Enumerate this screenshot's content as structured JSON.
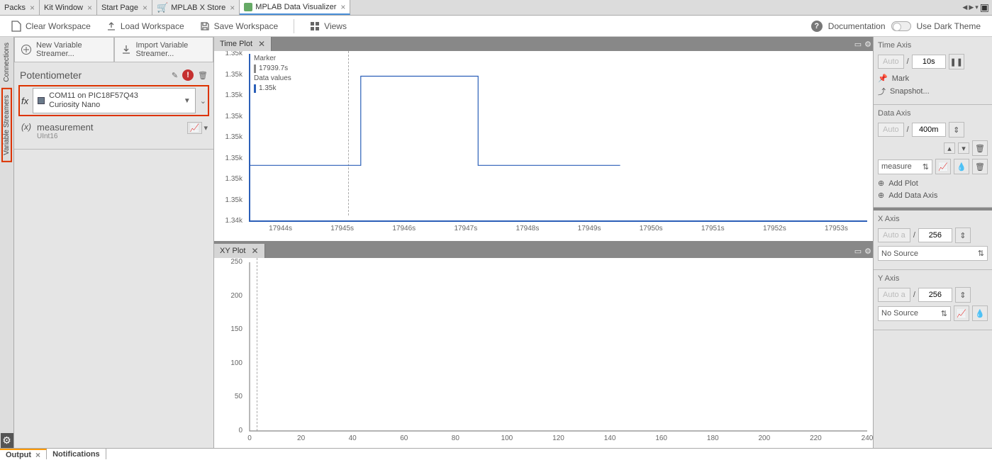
{
  "tabs": {
    "packs": "Packs",
    "kit": "Kit Window",
    "start": "Start Page",
    "store": "MPLAB X Store",
    "dv": "MPLAB Data Visualizer"
  },
  "toolbar": {
    "clear": "Clear Workspace",
    "load": "Load Workspace",
    "save": "Save Workspace",
    "views": "Views",
    "docs": "Documentation",
    "dark": "Use Dark Theme"
  },
  "leftRail": {
    "connections": "Connections",
    "streamers": "Variable Streamers"
  },
  "leftPanel": {
    "newBtn1": "New Variable",
    "newBtn2": "Streamer...",
    "importBtn1": "Import Variable",
    "importBtn2": "Streamer...",
    "streamerName": "Potentiometer",
    "sourceLine1": "COM11 on PIC18F57Q43",
    "sourceLine2": "Curiosity Nano",
    "varName": "measurement",
    "varType": "UInt16"
  },
  "timePlot": {
    "tab": "Time Plot",
    "legend": {
      "marker": "Marker",
      "markerTime": "17939.7s",
      "dataValues": "Data values",
      "value": "1.35k"
    },
    "yticks": [
      "1.35k",
      "1.35k",
      "1.35k",
      "1.35k",
      "1.35k",
      "1.35k",
      "1.35k",
      "1.35k",
      "1.34k"
    ],
    "xticks": [
      "17944s",
      "17945s",
      "17946s",
      "17947s",
      "17948s",
      "17949s",
      "17950s",
      "17951s",
      "17952s",
      "17953s"
    ]
  },
  "xyPlot": {
    "tab": "XY Plot",
    "yticks": [
      "250",
      "200",
      "150",
      "100",
      "50",
      "0"
    ],
    "xticks": [
      "0",
      "20",
      "40",
      "60",
      "80",
      "100",
      "120",
      "140",
      "160",
      "180",
      "200",
      "220",
      "240"
    ]
  },
  "rightPanel": {
    "timeAxis": "Time Axis",
    "dataAxis": "Data Axis",
    "xAxis": "X Axis",
    "yAxis": "Y Axis",
    "auto": "Auto",
    "autoA": "Auto a",
    "slash": "/",
    "timeRange": "10s",
    "dataRange": "400m",
    "xRange": "256",
    "yRange": "256",
    "mark": "Mark",
    "snapshot": "Snapshot...",
    "measure": "measure",
    "addPlot": "Add Plot",
    "addDataAxis": "Add Data Axis",
    "noSource": "No Source"
  },
  "bottom": {
    "output": "Output",
    "notifications": "Notifications"
  },
  "chart_data": [
    {
      "type": "line",
      "title": "Time Plot",
      "series": [
        {
          "name": "1.35k",
          "x": [
            17943.5,
            17945.3,
            17945.3,
            17947.2,
            17947.2,
            17949.5
          ],
          "y": [
            1.3495,
            1.3495,
            1.3503,
            1.3503,
            1.3495,
            1.3495
          ]
        }
      ],
      "xlabel": "",
      "ylabel": "",
      "xlim": [
        17943.5,
        17953.5
      ],
      "ylim": [
        1.349,
        1.3505
      ],
      "marker_x": 17945.1,
      "legend": {
        "Marker": "17939.7s",
        "Data values": "1.35k"
      }
    },
    {
      "type": "scatter",
      "title": "XY Plot",
      "series": [],
      "xlabel": "",
      "ylabel": "",
      "xlim": [
        0,
        256
      ],
      "ylim": [
        0,
        256
      ]
    }
  ]
}
